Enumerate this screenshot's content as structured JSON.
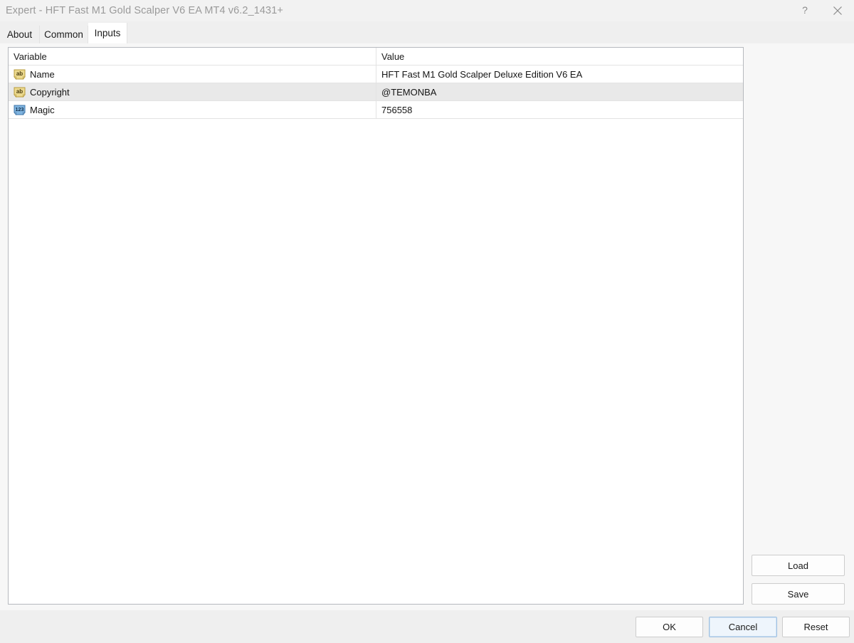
{
  "window": {
    "title": "Expert - HFT Fast M1 Gold Scalper V6 EA MT4 v6.2_1431+",
    "help_icon": "question-mark-icon",
    "close_icon": "close-icon"
  },
  "tabs": [
    {
      "label": "About",
      "active": false
    },
    {
      "label": "Common",
      "active": false
    },
    {
      "label": "Inputs",
      "active": true
    }
  ],
  "table": {
    "columns": {
      "variable": "Variable",
      "value": "Value"
    },
    "rows": [
      {
        "icon": "string-type-icon",
        "icon_text": "ab",
        "variable": "Name",
        "value": "HFT Fast M1 Gold Scalper Deluxe Edition V6 EA"
      },
      {
        "icon": "string-type-icon",
        "icon_text": "ab",
        "variable": "Copyright",
        "value": "@TEMONBA"
      },
      {
        "icon": "integer-type-icon",
        "icon_text": "123",
        "variable": "Magic",
        "value": "756558"
      }
    ]
  },
  "side_buttons": {
    "load": "Load",
    "save": "Save"
  },
  "footer_buttons": {
    "ok": "OK",
    "cancel": "Cancel",
    "reset": "Reset"
  },
  "colors": {
    "titlebar_bg": "#f2f2f2",
    "tabstrip_bg": "#efefef",
    "panel_bg": "#f7f7f7",
    "table_bg": "#ffffff",
    "alt_row_bg": "#e9e9e9",
    "focus_accent": "#9fc2e3",
    "string_icon": "#e8d48a",
    "integer_icon": "#7fb4e0"
  }
}
